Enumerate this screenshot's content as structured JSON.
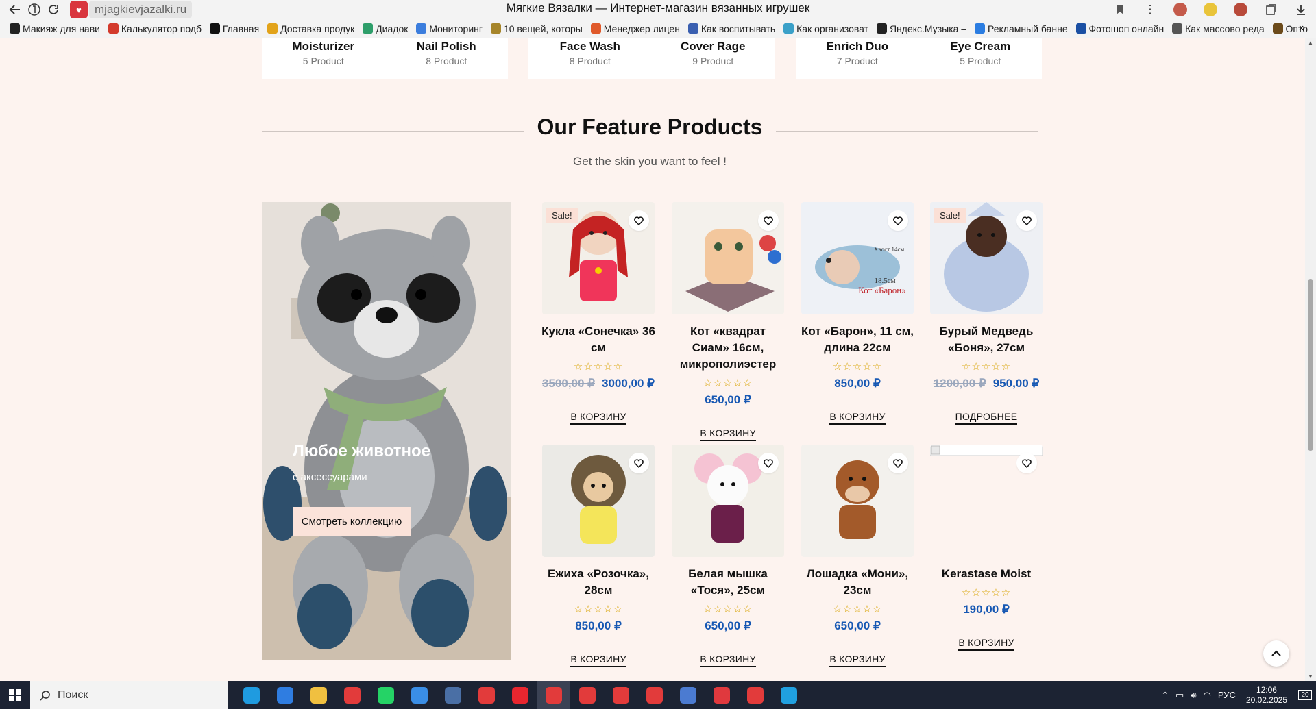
{
  "browser": {
    "url": "mjagkievjazalki.ru",
    "title": "Мягкие Вязалки — Интернет-магазин вязанных игрушек",
    "bookmarks": [
      {
        "label": "Макияж для нави",
        "color": "#222222"
      },
      {
        "label": "Калькулятор подб",
        "color": "#d33a2c"
      },
      {
        "label": "Главная",
        "color": "#111111"
      },
      {
        "label": "Доставка продук",
        "color": "#e2a31a"
      },
      {
        "label": "Диадок",
        "color": "#2e9e6a"
      },
      {
        "label": "Мониторинг",
        "color": "#3b7ddd"
      },
      {
        "label": "10 вещей, которы",
        "color": "#a6852a"
      },
      {
        "label": "Менеджер лицен",
        "color": "#e05a2b"
      },
      {
        "label": "Как воспитывать",
        "color": "#3a5fb0"
      },
      {
        "label": "Как организоват",
        "color": "#3aa0c8"
      },
      {
        "label": "Яндекс.Музыка –",
        "color": "#222222"
      },
      {
        "label": "Рекламный банне",
        "color": "#2b7de1"
      },
      {
        "label": "Фотошоп онлайн",
        "color": "#1a4fa3"
      },
      {
        "label": "Как массово реда",
        "color": "#555555"
      },
      {
        "label": "Опто",
        "color": "#6b4a1a"
      }
    ]
  },
  "categories": [
    {
      "items": [
        {
          "name": "Moisturizer",
          "count": "5 Product"
        },
        {
          "name": "Nail Polish",
          "count": "8 Product"
        }
      ]
    },
    {
      "items": [
        {
          "name": "Face Wash",
          "count": "8 Product"
        },
        {
          "name": "Cover Rage",
          "count": "9 Product"
        }
      ]
    },
    {
      "items": [
        {
          "name": "Enrich Duo",
          "count": "7 Product"
        },
        {
          "name": "Eye Cream",
          "count": "5 Product"
        }
      ]
    }
  ],
  "featured": {
    "heading": "Our Feature Products",
    "subheading": "Get the skin you want to feel !"
  },
  "banner": {
    "title": "Любое животное",
    "subtitle": "с аксессуарами",
    "button": "Смотреть коллекцию"
  },
  "products": [
    {
      "name": "Кукла «Сонечка» 36 см",
      "old_price": "3500,00 ₽",
      "price": "3000,00 ₽",
      "sale": "Sale!",
      "button": "В КОРЗИНУ",
      "img": "doll"
    },
    {
      "name": "Кот «квадрат Сиам» 16см, микрополиэстер",
      "old_price": "",
      "price": "650,00 ₽",
      "sale": "",
      "button": "В КОРЗИНУ",
      "img": "cat"
    },
    {
      "name": "Кот «Барон», 11 см, длина 22см",
      "old_price": "",
      "price": "850,00 ₽",
      "sale": "",
      "button": "В КОРЗИНУ",
      "img": "baron",
      "img_text": [
        "Хвост 14см",
        "18.5см",
        "Кот «Барон»"
      ]
    },
    {
      "name": "Бурый Медведь «Боня», 27см",
      "old_price": "1200,00 ₽",
      "price": "950,00 ₽",
      "sale": "Sale!",
      "button": "ПОДРОБНЕЕ",
      "img": "bear"
    },
    {
      "name": "Ежиха «Розочка», 28см",
      "old_price": "",
      "price": "850,00 ₽",
      "sale": "",
      "button": "В КОРЗИНУ",
      "img": "hedgehog"
    },
    {
      "name": "Белая мышка «Тося», 25см",
      "old_price": "",
      "price": "650,00 ₽",
      "sale": "",
      "button": "В КОРЗИНУ",
      "img": "mouse"
    },
    {
      "name": "Лошадка «Мони», 23см",
      "old_price": "",
      "price": "650,00 ₽",
      "sale": "",
      "button": "В КОРЗИНУ",
      "img": "horse"
    },
    {
      "name": "Kerastase Moist",
      "old_price": "",
      "price": "190,00 ₽",
      "sale": "",
      "button": "В КОРЗИНУ",
      "img": "broken"
    }
  ],
  "rating_glyphs": "☆☆☆☆☆",
  "taskbar": {
    "search_placeholder": "Поиск",
    "apps": [
      {
        "icon": "edge-icon",
        "color": "#1f9be0"
      },
      {
        "icon": "cloud-app-icon",
        "color": "#2f7de1"
      },
      {
        "icon": "folder-icon",
        "color": "#f0c040"
      },
      {
        "icon": "yandex-browser-icon",
        "color": "#e23b3b"
      },
      {
        "icon": "whatsapp-icon",
        "color": "#25d366"
      },
      {
        "icon": "store-icon",
        "color": "#3a8ee6"
      },
      {
        "icon": "calculator-icon",
        "color": "#4a6fa5"
      },
      {
        "icon": "yandex-browser-icon",
        "color": "#e23b3b"
      },
      {
        "icon": "opera-icon",
        "color": "#e8262f"
      },
      {
        "icon": "yandex-browser-icon",
        "color": "#e23b3b"
      },
      {
        "icon": "yandex-browser-icon",
        "color": "#e23b3b"
      },
      {
        "icon": "yandex-browser-icon",
        "color": "#e23b3b"
      },
      {
        "icon": "yandex-browser-icon",
        "color": "#e23b3b"
      },
      {
        "icon": "photo-app-icon",
        "color": "#4b7bd1"
      },
      {
        "icon": "anydesk-icon",
        "color": "#e0393e"
      },
      {
        "icon": "yandex-browser-icon",
        "color": "#e23b3b"
      },
      {
        "icon": "telegram-icon",
        "color": "#20a0e0"
      }
    ],
    "lang": "РУС",
    "time": "12:06",
    "date": "20.02.2025",
    "notifications": "20"
  }
}
